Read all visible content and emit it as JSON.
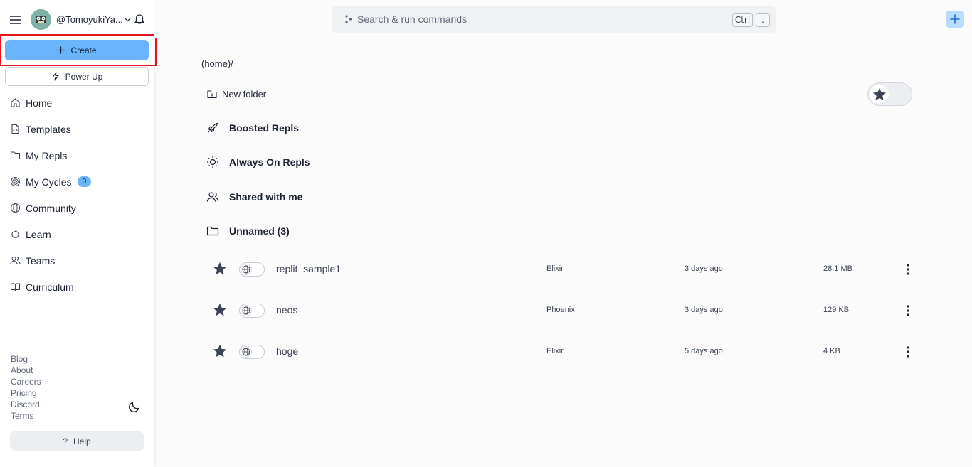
{
  "sidebar": {
    "username": "@TomoyukiYa...",
    "create_label": "Create",
    "powerup_label": "Power Up",
    "nav": [
      {
        "label": "Home",
        "icon": "home-icon"
      },
      {
        "label": "Templates",
        "icon": "templates-icon"
      },
      {
        "label": "My Repls",
        "icon": "folder-icon"
      },
      {
        "label": "My Cycles",
        "icon": "cycles-icon",
        "badge": "0"
      },
      {
        "label": "Community",
        "icon": "globe-icon"
      },
      {
        "label": "Learn",
        "icon": "learn-icon"
      },
      {
        "label": "Teams",
        "icon": "teams-icon"
      },
      {
        "label": "Curriculum",
        "icon": "book-icon"
      }
    ],
    "footer_links": [
      "Blog",
      "About",
      "Careers",
      "Pricing",
      "Discord",
      "Terms"
    ],
    "help_label": "Help"
  },
  "topbar": {
    "search_placeholder": "Search & run commands",
    "shortcut_ctrl": "Ctrl",
    "shortcut_dot": "."
  },
  "main": {
    "breadcrumb": "(home)/",
    "new_folder_label": "New folder",
    "folders": [
      {
        "label": "Boosted Repls",
        "icon": "rocket-icon"
      },
      {
        "label": "Always On Repls",
        "icon": "sun-icon"
      },
      {
        "label": "Shared with me",
        "icon": "users-icon"
      },
      {
        "label": "Unnamed (3)",
        "icon": "folder-icon"
      }
    ],
    "repls": [
      {
        "name": "replit_sample1",
        "language": "Elixir",
        "modified": "3 days ago",
        "size": "28.1 MB"
      },
      {
        "name": "neos",
        "language": "Phoenix",
        "modified": "3 days ago",
        "size": "129 KB"
      },
      {
        "name": "hoge",
        "language": "Elixir",
        "modified": "5 days ago",
        "size": "4 KB"
      }
    ]
  },
  "colors": {
    "accent_blue": "#6ab4fb",
    "highlight_red": "#e0161c",
    "plus_button_bg": "#b8dcff"
  }
}
